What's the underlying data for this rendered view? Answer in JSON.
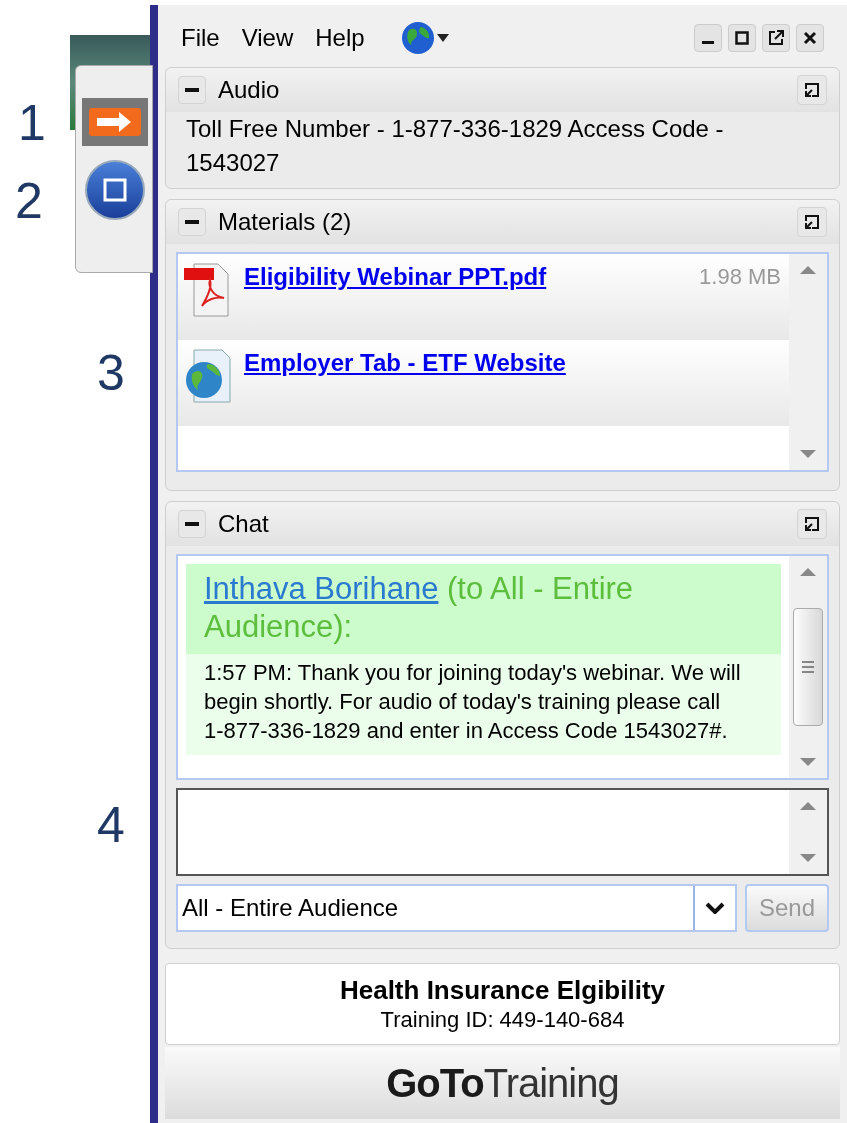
{
  "annotations": [
    "1",
    "2",
    "3",
    "4"
  ],
  "menu": [
    {
      "label": "File"
    },
    {
      "label": "View"
    },
    {
      "label": "Help"
    }
  ],
  "audio": {
    "title": "Audio",
    "text": "Toll Free Number - 1-877-336-1829 Access Code - 1543027"
  },
  "materials": {
    "title": "Materials (2)",
    "items": [
      {
        "kind": "pdf",
        "name": "Eligibility Webinar PPT.pdf",
        "size": "1.98 MB"
      },
      {
        "kind": "web",
        "name": "Employer Tab - ETF Website"
      }
    ]
  },
  "chat": {
    "title": "Chat",
    "messages": [
      {
        "sender": "Inthava Borihane",
        "recipient": "(to All - Entire Audience):",
        "text": "1:57 PM: Thank you for joining today's webinar. We will begin shortly. For audio of today's training please call 1-877-336-1829 and enter in Access Code 1543027#."
      }
    ],
    "recipient_select": "All - Entire Audience",
    "send": {
      "label": "Send",
      "disabled": true
    }
  },
  "footer": {
    "title": "Health Insurance Elgibility",
    "training_id": "Training ID: 449-140-684"
  },
  "brand": {
    "bold": "GoTo",
    "light": "Training"
  }
}
